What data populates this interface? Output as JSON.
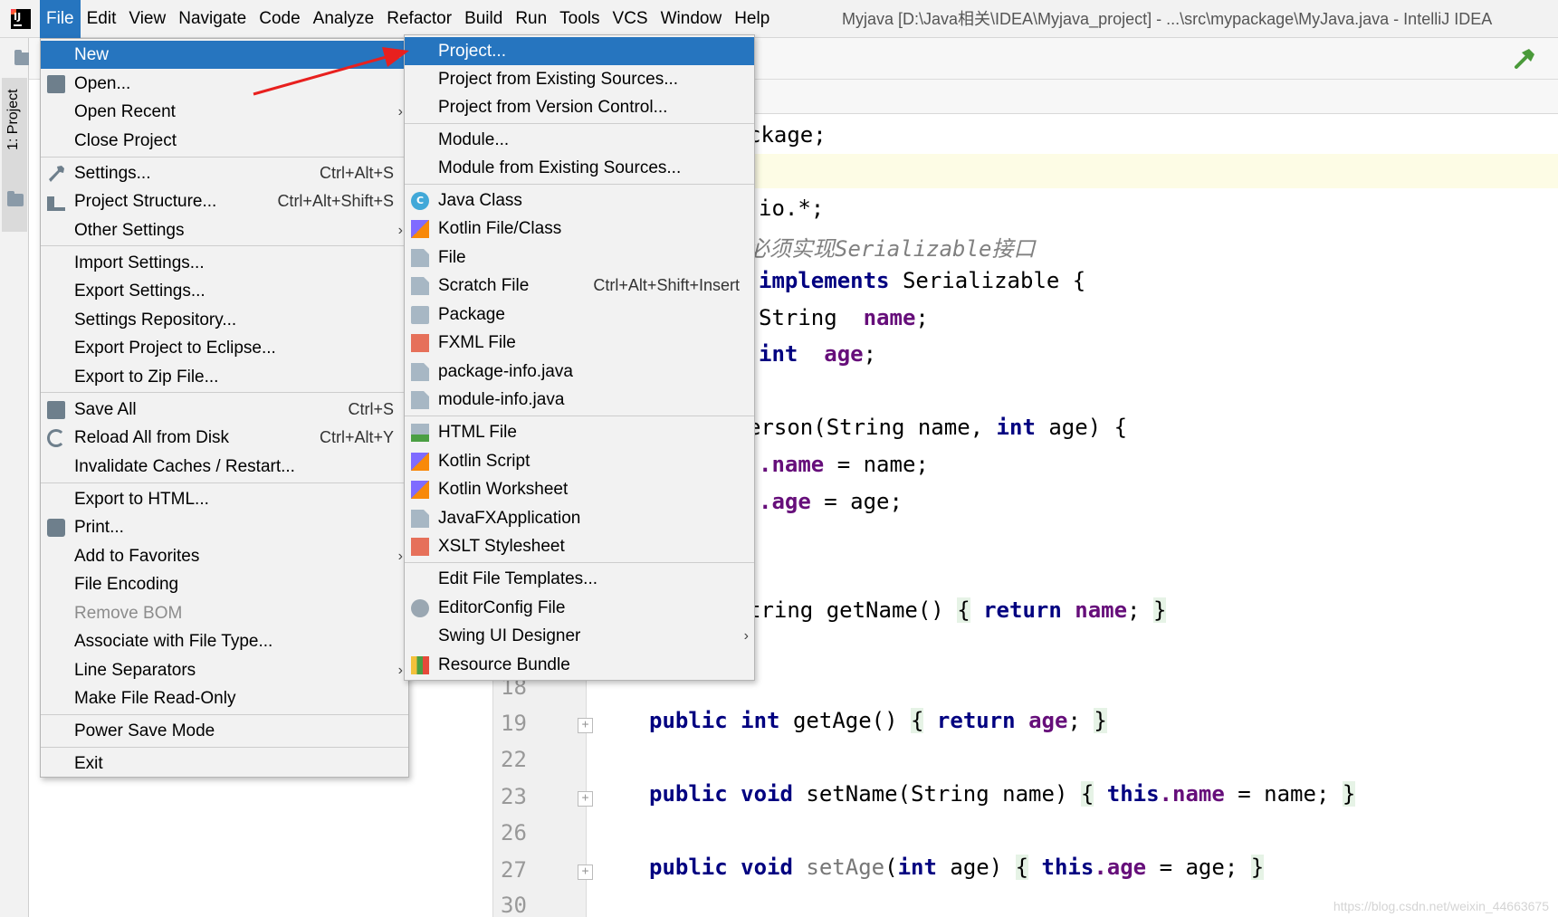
{
  "window": {
    "title": "Myjava [D:\\Java相关\\IDEA\\Myjava_project] - ...\\src\\mypackage\\MyJava.java - IntelliJ IDEA",
    "watermark": "https://blog.csdn.net/weixin_44663675"
  },
  "menubar": {
    "items": [
      "File",
      "Edit",
      "View",
      "Navigate",
      "Code",
      "Analyze",
      "Refactor",
      "Build",
      "Run",
      "Tools",
      "VCS",
      "Window",
      "Help"
    ],
    "active": "File"
  },
  "side_stripe": {
    "project_tab": "1: Project"
  },
  "file_menu": {
    "items": [
      {
        "label": "New",
        "submenu": true,
        "selected": true
      },
      {
        "label": "Open...",
        "icon": "folder-open-icon"
      },
      {
        "label": "Open Recent",
        "submenu": true
      },
      {
        "label": "Close Project"
      },
      {
        "label": "Settings...",
        "shortcut": "Ctrl+Alt+S",
        "icon": "wrench-icon"
      },
      {
        "label": "Project Structure...",
        "shortcut": "Ctrl+Alt+Shift+S",
        "icon": "project-structure-icon"
      },
      {
        "label": "Other Settings",
        "submenu": true
      },
      {
        "label": "Import Settings..."
      },
      {
        "label": "Export Settings..."
      },
      {
        "label": "Settings Repository..."
      },
      {
        "label": "Export Project to Eclipse..."
      },
      {
        "label": "Export to Zip File..."
      },
      {
        "label": "Save All",
        "shortcut": "Ctrl+S",
        "icon": "save-icon"
      },
      {
        "label": "Reload All from Disk",
        "shortcut": "Ctrl+Alt+Y",
        "icon": "reload-icon"
      },
      {
        "label": "Invalidate Caches / Restart..."
      },
      {
        "label": "Export to HTML..."
      },
      {
        "label": "Print...",
        "icon": "print-icon"
      },
      {
        "label": "Add to Favorites",
        "submenu": true
      },
      {
        "label": "File Encoding"
      },
      {
        "label": "Remove BOM",
        "disabled": true
      },
      {
        "label": "Associate with File Type..."
      },
      {
        "label": "Line Separators",
        "submenu": true
      },
      {
        "label": "Make File Read-Only"
      },
      {
        "label": "Power Save Mode"
      },
      {
        "label": "Exit"
      }
    ]
  },
  "new_menu": {
    "items": [
      {
        "label": "Project...",
        "selected": true
      },
      {
        "label": "Project from Existing Sources..."
      },
      {
        "label": "Project from Version Control..."
      },
      {
        "label": "Module..."
      },
      {
        "label": "Module from Existing Sources..."
      },
      {
        "label": "Java Class",
        "icon": "java-class-icon",
        "badge": "C"
      },
      {
        "label": "Kotlin File/Class",
        "icon": "kotlin-file-icon"
      },
      {
        "label": "File",
        "icon": "file-icon"
      },
      {
        "label": "Scratch File",
        "shortcut": "Ctrl+Alt+Shift+Insert",
        "icon": "scratch-file-icon"
      },
      {
        "label": "Package",
        "icon": "package-icon"
      },
      {
        "label": "FXML File",
        "icon": "fxml-file-icon"
      },
      {
        "label": "package-info.java",
        "icon": "java-file-icon"
      },
      {
        "label": "module-info.java",
        "icon": "java-file-icon"
      },
      {
        "label": "HTML File",
        "icon": "html-file-icon"
      },
      {
        "label": "Kotlin Script",
        "icon": "kotlin-script-icon"
      },
      {
        "label": "Kotlin Worksheet",
        "icon": "kotlin-worksheet-icon"
      },
      {
        "label": "JavaFXApplication",
        "icon": "javafx-app-icon"
      },
      {
        "label": "XSLT Stylesheet",
        "icon": "xslt-icon"
      },
      {
        "label": "Edit File Templates..."
      },
      {
        "label": "EditorConfig File",
        "icon": "gear-icon"
      },
      {
        "label": "Swing UI Designer",
        "submenu": true
      },
      {
        "label": "Resource Bundle",
        "icon": "resource-bundle-icon"
      }
    ]
  },
  "editor": {
    "line_numbers": [
      "18",
      "19",
      "22",
      "23",
      "26",
      "27",
      "30"
    ],
    "code": {
      "l1": "ckage;",
      "l2": "io.*;",
      "l3": "必须实现Serializable接口",
      "l4_kw": "implements",
      "l4_rest": " Serializable {",
      "l5_type": "String",
      "l5_field": "name",
      "l6_kw": "int",
      "l6_field": "age",
      "l7_a": "erson(String name, ",
      "l7_kw": "int",
      "l7_b": " age) {",
      "l8_field": ".name",
      "l8_rest": " = name;",
      "l9_field": ".age",
      "l9_rest": " = age;",
      "l10_a": "tring getName() ",
      "l10_kw": "return",
      "l10_field": "name",
      "l11_kw1": "public",
      "l11_kw2": "int",
      "l11_rest": " getAge() ",
      "l11_ret": "return",
      "l11_field": "age",
      "l12_kw1": "public",
      "l12_kw2": "void",
      "l12_rest": " setName(String name) ",
      "l12_this": "this",
      "l12_field": ".name",
      "l12_tail": " = name; ",
      "l13_kw1": "public",
      "l13_kw2": "void",
      "l13_dim": " setAge",
      "l13_int": "int",
      "l13_mid": " age) ",
      "l13_this": "this",
      "l13_field": ".age",
      "l13_tail": " = age; "
    }
  },
  "colors": {
    "accent": "#2675bf",
    "keyword": "#000080",
    "field": "#660e7a",
    "annotation_arrow": "#e8201e"
  }
}
